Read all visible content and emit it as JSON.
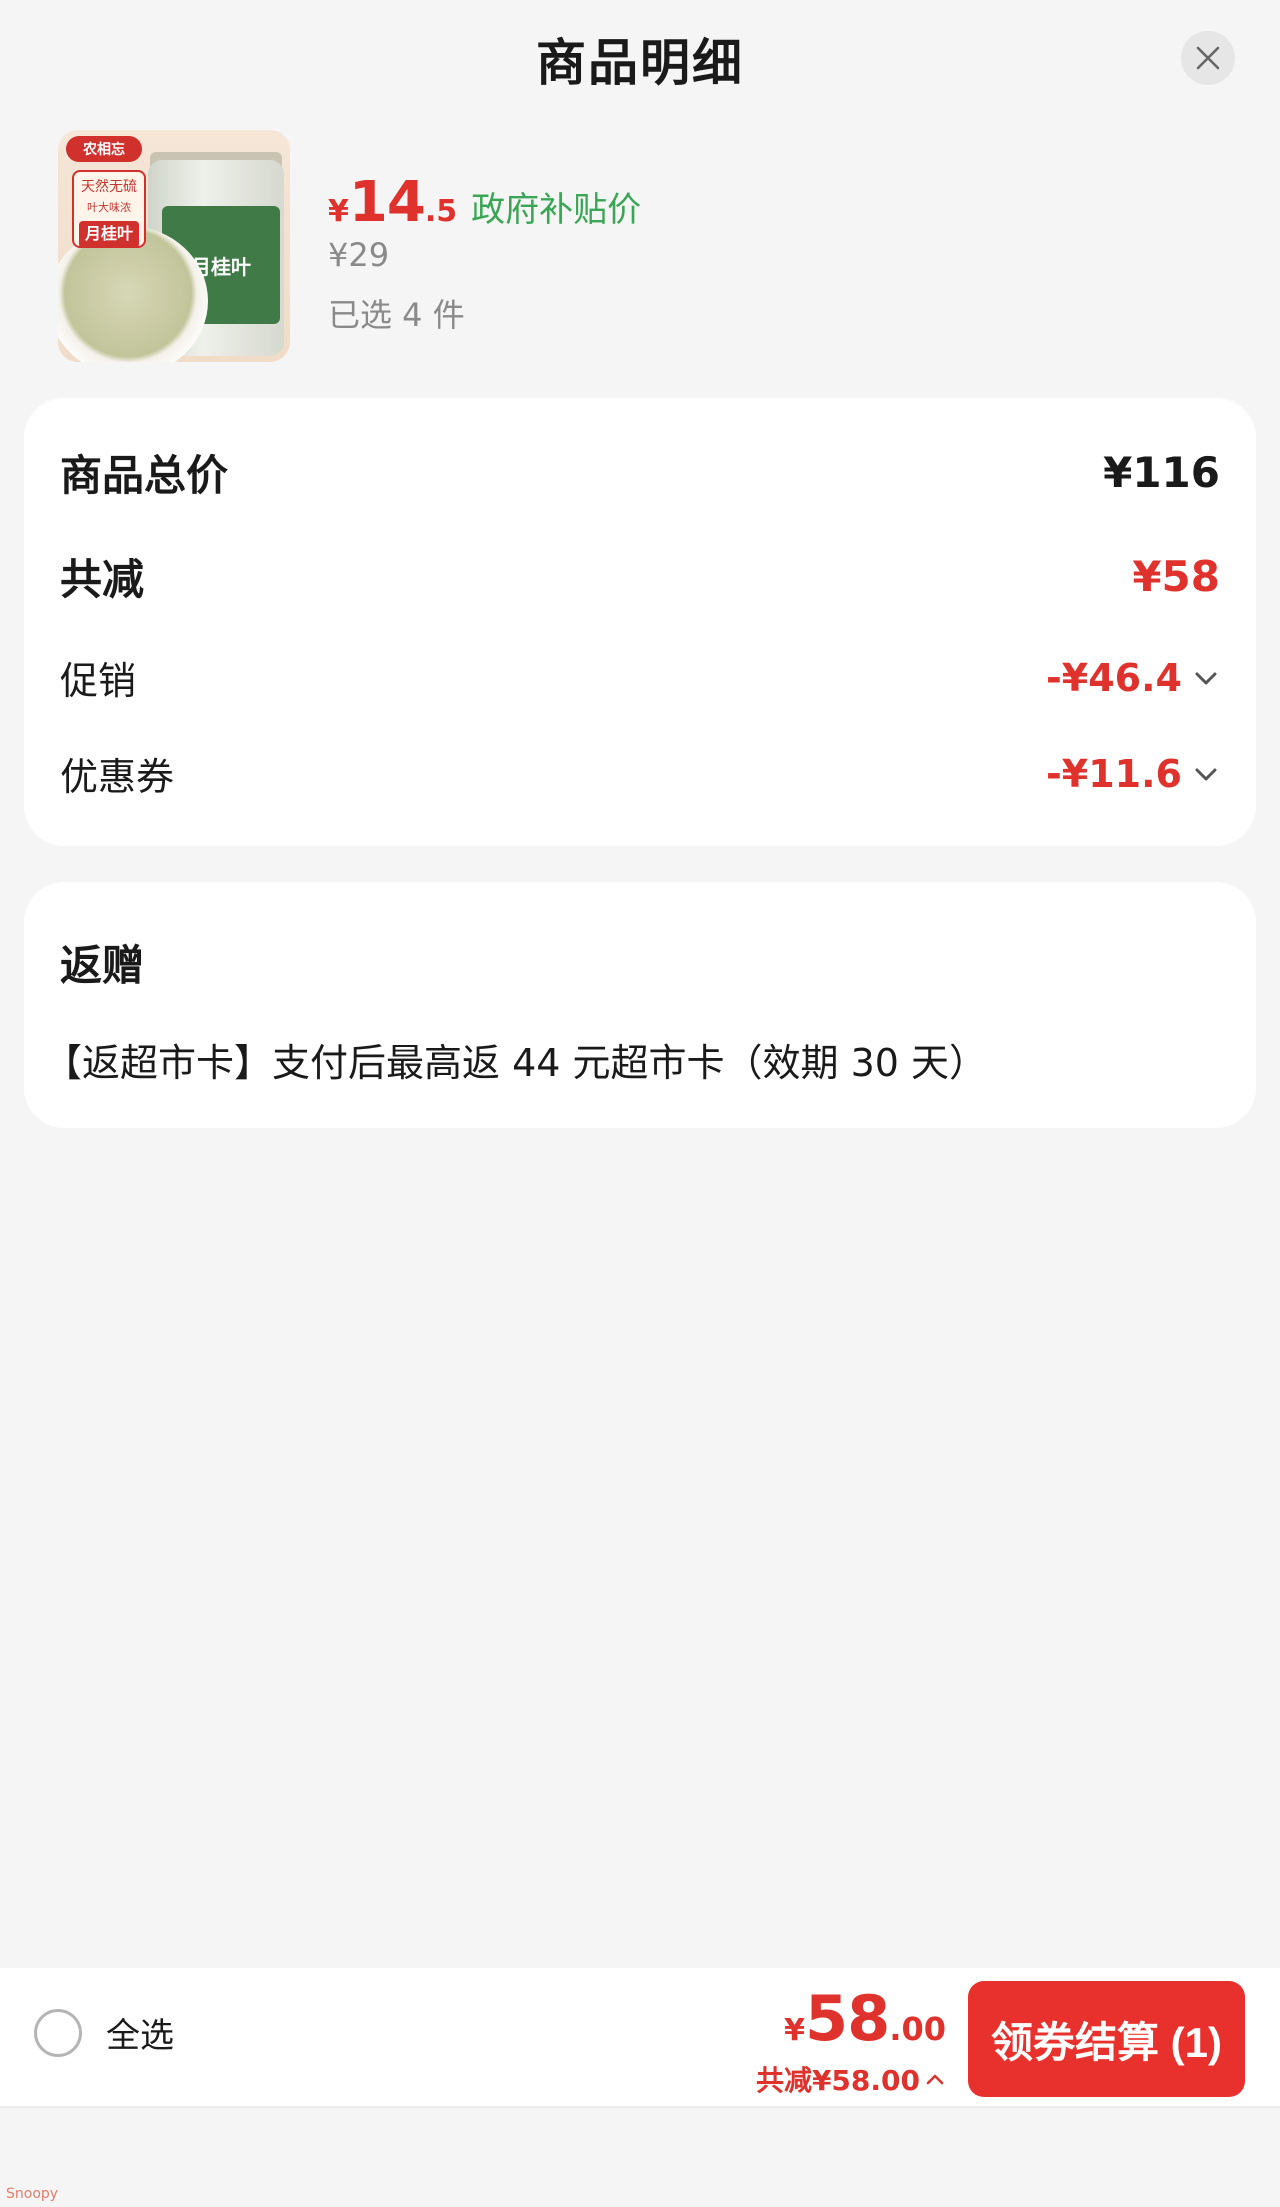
{
  "header": {
    "title": "商品明细"
  },
  "product": {
    "image_brand_tag": "农相忘",
    "image_tag_line1": "天然无硫",
    "image_tag_line2": "叶大味浓",
    "image_tag_name": "月桂叶",
    "image_jar_label": "月桂叶",
    "price_symbol": "¥",
    "price_int": "14",
    "price_dec": ".5",
    "subsidy_label": "政府补贴价",
    "original_price": "¥29",
    "selected_count": "已选 4 件"
  },
  "summary": {
    "total_label": "商品总价",
    "total_value": "¥116",
    "discount_label": "共减",
    "discount_value": "¥58",
    "promo_label": "促销",
    "promo_value": "-¥46.4",
    "coupon_label": "优惠券",
    "coupon_value": "-¥11.6"
  },
  "gift": {
    "title": "返赠",
    "description": "【返超市卡】支付后最高返 44 元超市卡（效期 30 天）"
  },
  "bottom_bar": {
    "select_all_label": "全选",
    "price_symbol": "¥",
    "price_int": "58",
    "price_dec": ".00",
    "discount_text": "共减¥58.00",
    "checkout_label": "领券结算 (1)"
  },
  "watermark": "Snoopy",
  "colors": {
    "accent_red": "#e0322c",
    "subsidy_green": "#3aa655",
    "background": "#f5f5f5"
  }
}
